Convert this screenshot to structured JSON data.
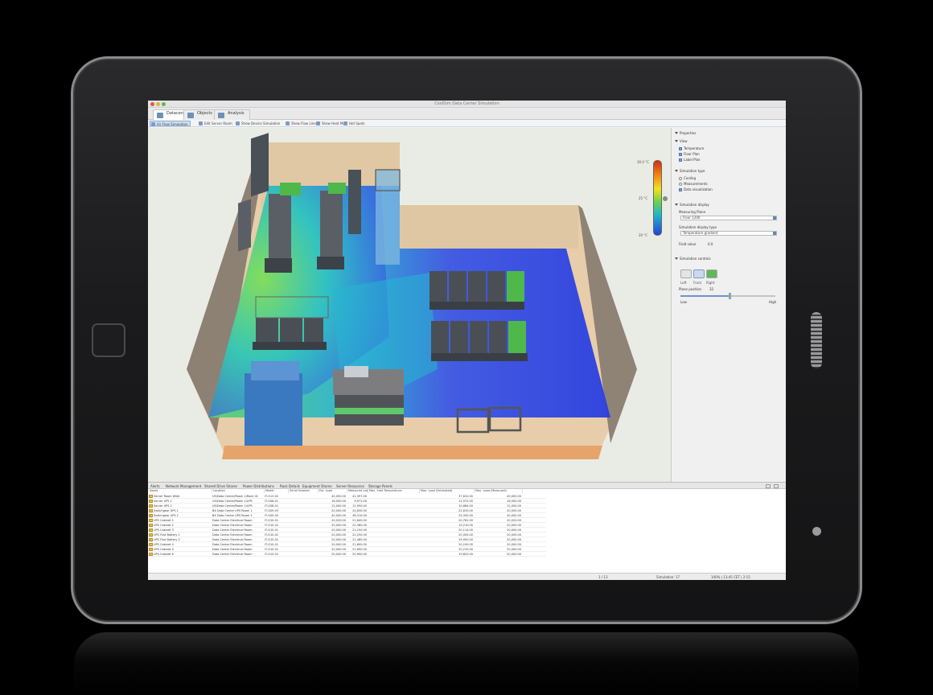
{
  "window": {
    "title": "CoolSim Data Center Simulation"
  },
  "tabs": [
    {
      "label": "Datacenter"
    },
    {
      "label": "Objects"
    },
    {
      "label": "Analysis"
    }
  ],
  "toolbar": {
    "items": [
      {
        "label": "Air Flow Simulation"
      },
      {
        "label": "Edit Server Room"
      },
      {
        "label": "Show Device Simulation"
      },
      {
        "label": "Show Flow Lines"
      },
      {
        "label": "Show Heat Map"
      },
      {
        "label": "Hot Spots"
      }
    ]
  },
  "legend": {
    "max_label": "30.0 °C",
    "mid_label": "25 °C",
    "min_label": "20 °C"
  },
  "panel": {
    "sections": [
      {
        "label": "Properties"
      },
      {
        "label": "View"
      },
      {
        "label": "Simulation type"
      },
      {
        "label": "Simulation display"
      },
      {
        "label": "Simulation controls"
      }
    ],
    "view_options": [
      "Temperature",
      "Floor Plan",
      "Label Plan"
    ],
    "sim_types": [
      "Cooling",
      "Measurements",
      "Data visualization"
    ],
    "display_label_1": "Measuring Plane",
    "display_value_1": "Floor 1200",
    "display_label_2": "Simulation display type",
    "display_value_2": "Temperature gradient",
    "field_label": "Field value",
    "field_value": "0.0",
    "view_button_labels": [
      "Left",
      "Front",
      "Right"
    ],
    "cutting_label": "Plane position",
    "cutting_value": "32",
    "slider_min": "Low",
    "slider_max": "High",
    "slider_level": 0.52
  },
  "bottom_tabs": [
    "Alerts",
    "Network Management",
    "Shared Drive Shares",
    "Power Distributions",
    "Rack Details",
    "Equipment Shares",
    "Server Resources",
    "Storage Panels"
  ],
  "table": {
    "columns": [
      "Name",
      "Location",
      "Model",
      "Serial Number",
      "Est. Load",
      "Measured Load",
      "Max. Inlet Temperature",
      "Max. Load (Estimated)",
      "Max. Load (Measured)"
    ],
    "rows": [
      [
        "Server Room Wide",
        "US/Data Center/Room 1/Rack 01",
        "IT-G13-02",
        "",
        "40,000.00",
        "41,397.00",
        "",
        "37,810.00",
        "40,000.00"
      ],
      [
        "Server UPS 1",
        "US/Data Center/Room 1/UPS",
        "IT-G08-01",
        "",
        "16,000.00",
        "9,971.00",
        "",
        "11,972.00",
        "16,000.00"
      ],
      [
        "Server UPS 2",
        "US/Data Center/Room 1/UPS",
        "IT-G08-01",
        "",
        "12,000.00",
        "12,950.00",
        "",
        "10,684.00",
        "12,000.00"
      ],
      [
        "Switchgear UPS 1",
        "BX Data Center UPS Room 1",
        "IT-G09-03",
        "",
        "20,000.00",
        "24,830.00",
        "",
        "22,810.00",
        "20,000.00"
      ],
      [
        "Switchgear UPS 2",
        "BX Data Center UPS Room 1",
        "IT-G09-03",
        "",
        "40,000.00",
        "46,310.00",
        "",
        "29,350.00",
        "40,000.00"
      ],
      [
        "UPS Cabinet 1",
        "Data Center Electrical Room",
        "IT-G10-01",
        "",
        "20,020.00",
        "21,640.00",
        "",
        "20,781.00",
        "20,020.00"
      ],
      [
        "UPS Cabinet 2",
        "Data Center Electrical Room",
        "IT-G10-01",
        "",
        "20,000.00",
        "22,360.00",
        "",
        "19,210.00",
        "20,000.00"
      ],
      [
        "UPS Cabinet 3",
        "Data Center Electrical Room",
        "IT-G10-01",
        "",
        "20,000.00",
        "21,150.00",
        "",
        "20,114.00",
        "20,000.00"
      ],
      [
        "UPS First Battery 1",
        "Data Center Electrical Room",
        "IT-G10-02",
        "",
        "20,000.00",
        "22,250.00",
        "",
        "20,005.00",
        "20,000.00"
      ],
      [
        "UPS First Battery 2",
        "Data Center Electrical Room",
        "IT-G10-02",
        "",
        "20,000.00",
        "21,480.00",
        "",
        "19,950.00",
        "20,000.00"
      ],
      [
        "UPS Cabinet 4",
        "Data Center Electrical Room",
        "IT-G10-01",
        "",
        "20,000.00",
        "21,600.00",
        "",
        "20,190.00",
        "20,000.00"
      ],
      [
        "UPS Cabinet 5",
        "Data Center Electrical Room",
        "IT-G10-01",
        "",
        "20,000.00",
        "21,690.00",
        "",
        "20,210.00",
        "20,000.00"
      ],
      [
        "UPS Cabinet 6",
        "Data Center Electrical Room",
        "IT-G10-01",
        "",
        "20,000.00",
        "20,900.00",
        "",
        "19,820.00",
        "20,000.00"
      ]
    ]
  },
  "status": {
    "left": "1 / 13",
    "mid": "Simulation: 17",
    "right": "100% | 13:45 CET | 2:15"
  },
  "colors": {
    "hot": "#d62a12",
    "warm": "#f4e020",
    "mid": "#6fd24a",
    "cool": "#22b8c8",
    "cold": "#2244dc",
    "accent": "#5f86c8"
  }
}
